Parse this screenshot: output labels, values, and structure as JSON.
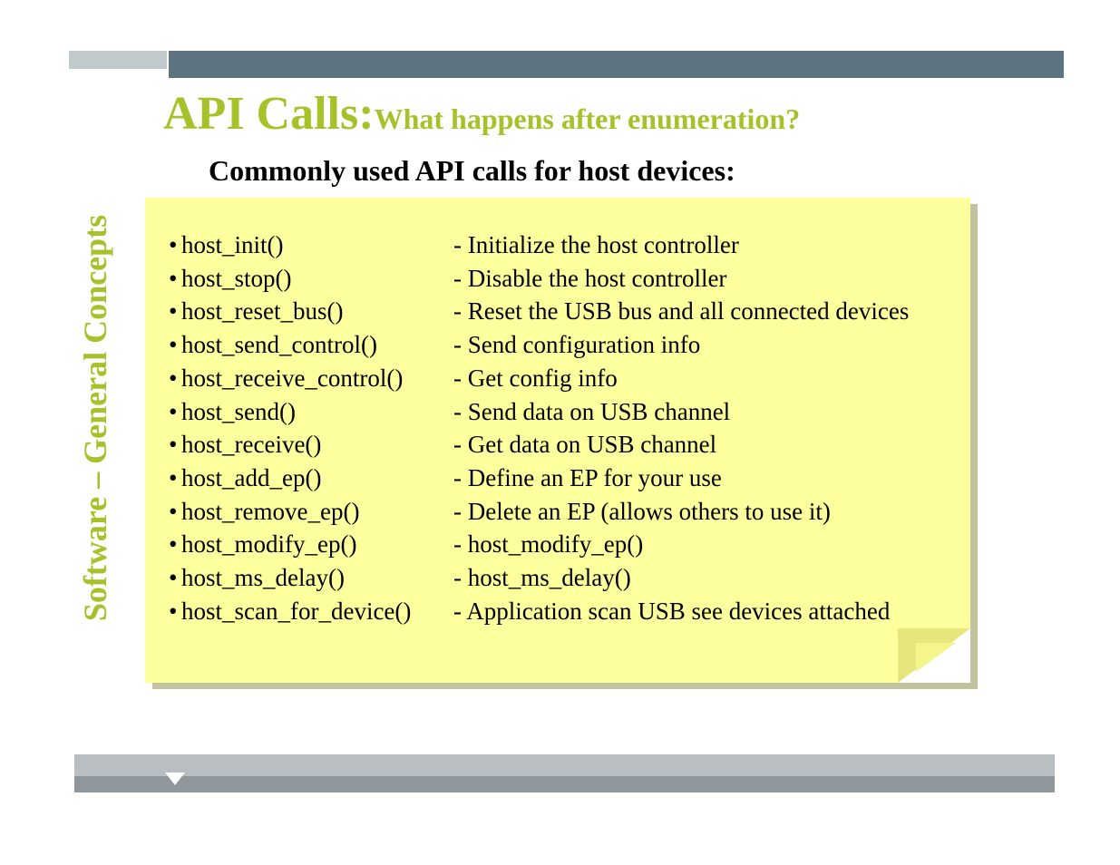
{
  "side_label": "Software – General Concepts",
  "title_main": "API Calls:",
  "title_sub": "What happens after enumeration?",
  "subheading": "Commonly used API calls for host devices:",
  "api_calls": [
    {
      "fn": "host_init()",
      "desc": "- Initialize the host controller"
    },
    {
      "fn": "host_stop()",
      "desc": "- Disable the host controller"
    },
    {
      "fn": "host_reset_bus()",
      "desc": "- Reset the USB bus and all connected devices"
    },
    {
      "fn": "host_send_control()",
      "desc": "- Send configuration info"
    },
    {
      "fn": "host_receive_control()",
      "desc": "- Get config info"
    },
    {
      "fn": "host_send()",
      "desc": "- Send data on USB channel"
    },
    {
      "fn": "host_receive()",
      "desc": "- Get data on USB channel"
    },
    {
      "fn": "host_add_ep()",
      "desc": "- Define an EP for your use"
    },
    {
      "fn": "host_remove_ep()",
      "desc": "- Delete an EP (allows others to use it)"
    },
    {
      "fn": "host_modify_ep()",
      "desc": "- host_modify_ep()"
    },
    {
      "fn": "host_ms_delay()",
      "desc": "- host_ms_delay()"
    },
    {
      "fn": "host_scan_for_device()",
      "desc": "- Application scan USB see devices attached"
    }
  ],
  "colors": {
    "accent_green": "#a6c22a",
    "note_bg": "#feff9d",
    "topbar_dark": "#5d7380"
  }
}
